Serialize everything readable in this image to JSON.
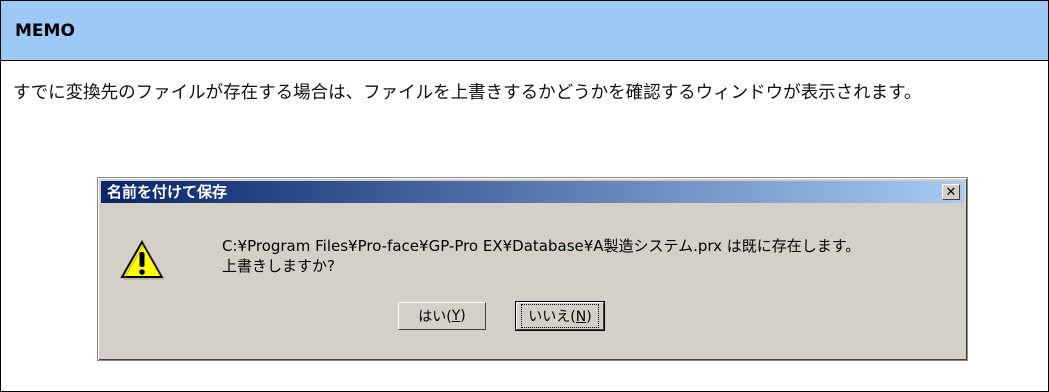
{
  "memo": {
    "title": "MEMO",
    "body": "すでに変換先のファイルが存在する場合は、ファイルを上書きするかどうかを確認するウィンドウが表示されます。"
  },
  "dialog": {
    "title": "名前を付けて保存",
    "message_line1": "C:¥Program Files¥Pro-face¥GP-Pro EX¥Database¥A製造システム.prx は既に存在します。",
    "message_line2": "上書きしますか?",
    "yes_label": "はい(",
    "yes_key": "Y",
    "no_label": "いいえ(",
    "no_key": "N",
    "close_glyph": "✕",
    "icon": "warning-icon"
  }
}
